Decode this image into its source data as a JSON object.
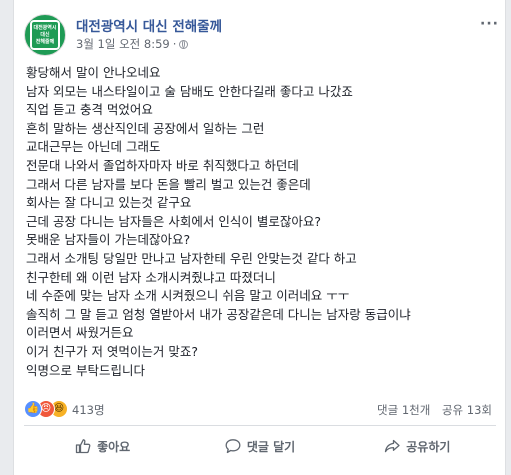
{
  "post": {
    "page_name": "대전광역시 대신 전해줄께",
    "date": "3월 1일 오전 8:59",
    "separator": "·",
    "more_label": "···",
    "logo_lines": [
      "대전광역시",
      "대신",
      "전해줄께"
    ],
    "body_lines": [
      "황당해서 말이 안나오네요",
      "남자 외모는 내스타일이고 술 담배도 안한다길래 좋다고 나갔죠",
      "직업 듣고 충격 먹었어요",
      "흔히 말하는 생산직인데 공장에서 일하는 그런",
      "교대근무는 아닌데 그래도",
      "전문대 나와서 졸업하자마자 바로 취직했다고 하던데",
      "그래서 다른 남자를 보다 돈을 빨리 벌고 있는건 좋은데",
      "회사는 잘 다니고 있는것 같구요",
      "근데 공장 다니는 남자들은 사회에서 인식이 별로잖아요?",
      "못배운 남자들이 가는데잖아요?",
      "그래서 소개팅 당일만 만나고 남자한테 우린 안맞는것 같다 하고",
      "친구한테 왜 이런 남자 소개시켜줬냐고 따졌더니",
      "네 수준에 맞는 남자 소개 시켜줬으니 쉬음 말고 이러네요 ㅜㅜ",
      "솔직히 그 말 듣고 엄청 열받아서 내가 공장같은데 다니는 남자랑 동급이냐",
      "이러면서 싸웠거든요",
      "이거 친구가 저 엿먹이는거 맞죠?",
      "익명으로 부탁드립니다"
    ]
  },
  "reactions": {
    "count": "413명",
    "comments": "댓글 1천개",
    "shares": "공유 13회",
    "icons": [
      "like-icon",
      "angry-icon",
      "haha-icon"
    ]
  },
  "actions": {
    "like": "좋아요",
    "comment": "댓글 달기",
    "share": "공유하기"
  },
  "colors": {
    "page_name": "#365899",
    "logo_bg": "#1f9b55",
    "like_reaction": "#5890ff",
    "angry_reaction": "#f0573b",
    "haha_reaction": "#f7b125"
  }
}
